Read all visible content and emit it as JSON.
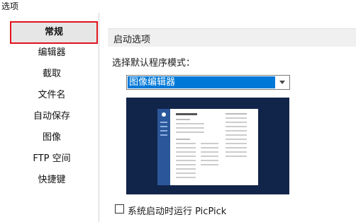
{
  "window": {
    "title": "选项"
  },
  "sidebar": {
    "items": [
      {
        "label": "常规",
        "selected": true
      },
      {
        "label": "编辑器"
      },
      {
        "label": "截取"
      },
      {
        "label": "文件名"
      },
      {
        "label": "自动保存"
      },
      {
        "label": "图像"
      },
      {
        "label": "FTP 空间"
      },
      {
        "label": "快捷键"
      }
    ]
  },
  "main": {
    "section_title": "启动选项",
    "mode_label": "选择默认程序模式：",
    "mode_select": {
      "value": "图像编辑器"
    },
    "preview": {
      "icon": "editor-startup-preview-image"
    },
    "startup_checkbox": {
      "label": "系统启动时运行 PicPick",
      "checked": false
    }
  },
  "colors": {
    "selection_border": "#e0141e",
    "select_highlight": "#0078d7",
    "preview_bg": "#11244a"
  }
}
